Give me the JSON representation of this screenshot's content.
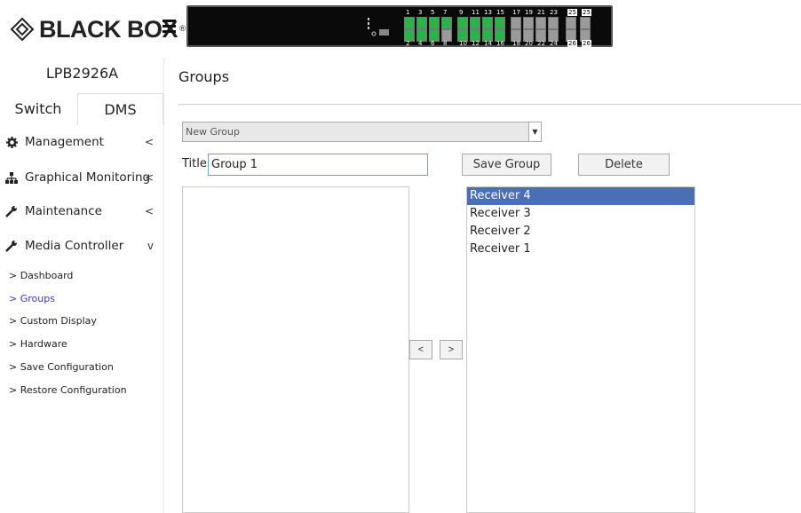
{
  "brand": {
    "name": "BLACK BOX",
    "reg": "®"
  },
  "switch_ports": {
    "top_numbers": [
      "1",
      "3",
      "5",
      "7",
      "9",
      "11",
      "13",
      "15",
      "17",
      "19",
      "21",
      "23",
      "25",
      "25"
    ],
    "bottom_numbers": [
      "2",
      "4",
      "6",
      "8",
      "10",
      "12",
      "14",
      "16",
      "18",
      "20",
      "22",
      "24",
      "26",
      "26"
    ]
  },
  "sidebar": {
    "device_name": "LPB2926A",
    "tabs": [
      {
        "label": "Switch"
      },
      {
        "label": "DMS"
      }
    ],
    "menu": [
      {
        "label": "Management",
        "icon": "gear-icon",
        "caret": "<"
      },
      {
        "label": "Graphical Monitoring",
        "icon": "sitemap-icon",
        "caret": "<"
      },
      {
        "label": "Maintenance",
        "icon": "wrench-icon",
        "caret": "<"
      },
      {
        "label": "Media Controller",
        "icon": "wrench-icon",
        "caret": "v"
      }
    ],
    "submenu": [
      {
        "label": "> Dashboard"
      },
      {
        "label": "> Groups"
      },
      {
        "label": "> Custom Display"
      },
      {
        "label": "> Hardware"
      },
      {
        "label": "> Save Configuration"
      },
      {
        "label": "> Restore Configuration"
      }
    ]
  },
  "main": {
    "page_title": "Groups",
    "group_select": {
      "value": "New Group"
    },
    "title_field": {
      "label": "Title",
      "value": "Group 1"
    },
    "buttons": {
      "save": "Save Group",
      "delete": "Delete",
      "move_left": "<",
      "move_right": ">"
    },
    "left_list": [],
    "right_list": [
      "Receiver 4",
      "Receiver 3",
      "Receiver 2",
      "Receiver 1"
    ],
    "selected_right": "Receiver 4"
  },
  "colors": {
    "selected_bg": "#4a6fb5",
    "port_green": "#2bb24a",
    "active_sub": "#3a3aa8"
  }
}
